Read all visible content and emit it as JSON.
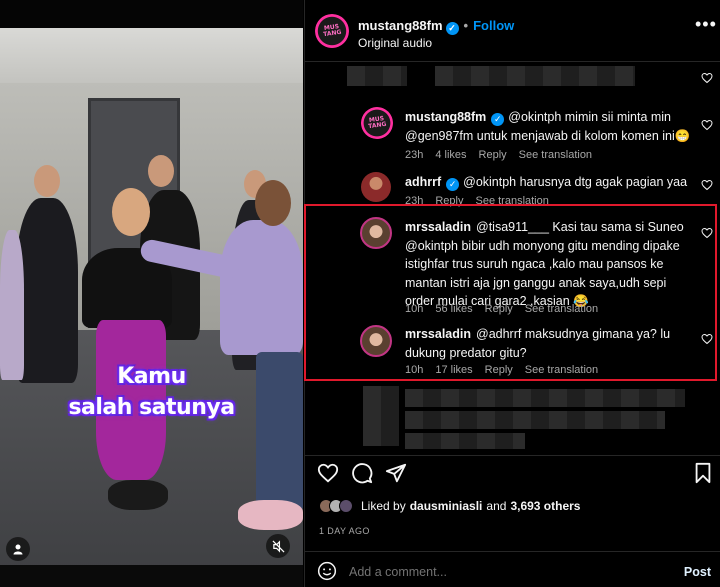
{
  "video": {
    "caption_line1": "Kamu",
    "caption_line2": "salah satunya",
    "person_icon": "person-icon",
    "mute_icon": "muted-speaker-icon"
  },
  "header": {
    "username": "mustang88fm",
    "follow_label": "Follow",
    "separator": "•",
    "subtitle": "Original audio",
    "avatar_text": "MUS TANG",
    "more_icon": "more-horizontal-icon"
  },
  "comments": [
    {
      "username": "mustang88fm",
      "verified": true,
      "text": "@okintph mimin sii minta min @gen987fm untuk menjawab di kolom komen ini😁",
      "age": "23h",
      "likes": "4 likes",
      "reply": "Reply",
      "translate": "See translation"
    },
    {
      "username": "adhrrf",
      "verified": true,
      "text": "@okintph harusnya dtg agak pagian yaa",
      "age": "23h",
      "likes": "",
      "reply": "Reply",
      "translate": "See translation"
    },
    {
      "username": "mrssaladin",
      "verified": false,
      "text": "@tisa911___ Kasi tau sama si Suneo @okintph bibir udh monyong gitu mending dipake istighfar trus suruh ngaca ,kalo mau pansos ke mantan istri aja jgn ganggu anak saya,udh sepi order mulai cari gara2 ,kasian 😂",
      "age": "10h",
      "likes": "56 likes",
      "reply": "Reply",
      "translate": "See translation"
    },
    {
      "username": "mrssaladin",
      "verified": false,
      "text": "@adhrrf maksudnya gimana ya? lu dukung predator gitu?",
      "age": "10h",
      "likes": "17 likes",
      "reply": "Reply",
      "translate": "See translation"
    }
  ],
  "actions": {
    "like_icon": "heart-icon",
    "comment_icon": "comment-icon",
    "share_icon": "share-icon",
    "save_icon": "bookmark-icon",
    "liked_by_prefix": "Liked by",
    "liked_by_user": "dausminiasli",
    "liked_by_and": "and",
    "liked_by_others": "3,693 others",
    "timestamp": "1 DAY AGO"
  },
  "add_comment": {
    "placeholder": "Add a comment...",
    "post_label": "Post",
    "emoji_icon": "emoji-icon"
  },
  "colors": {
    "accent": "#0095f6",
    "highlight_border": "#e0192c",
    "background": "#000000",
    "muted_text": "#a8a8a8"
  }
}
